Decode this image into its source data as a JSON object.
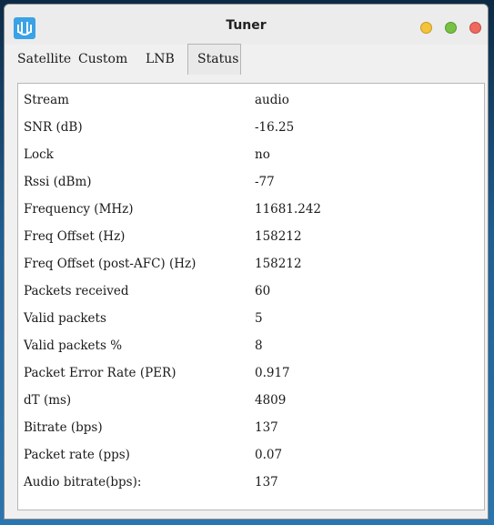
{
  "window": {
    "title": "Tuner"
  },
  "tabs": [
    {
      "label": "Satellite"
    },
    {
      "label": "Custom"
    },
    {
      "label": "LNB"
    },
    {
      "label": "Status"
    }
  ],
  "status": {
    "rows": [
      {
        "label": "Stream",
        "value": "audio"
      },
      {
        "label": "SNR (dB)",
        "value": "-16.25"
      },
      {
        "label": "Lock",
        "value": "no"
      },
      {
        "label": "Rssi (dBm)",
        "value": "-77"
      },
      {
        "label": "Frequency (MHz)",
        "value": "11681.242"
      },
      {
        "label": "Freq Offset (Hz)",
        "value": "158212"
      },
      {
        "label": "Freq Offset (post-AFC) (Hz)",
        "value": "158212"
      },
      {
        "label": "Packets received",
        "value": "60"
      },
      {
        "label": "Valid packets",
        "value": "5"
      },
      {
        "label": "Valid packets %",
        "value": "8"
      },
      {
        "label": "Packet Error Rate (PER)",
        "value": "0.917"
      },
      {
        "label": "dT (ms)",
        "value": "4809"
      },
      {
        "label": "Bitrate (bps)",
        "value": "137"
      },
      {
        "label": "Packet rate (pps)",
        "value": "0.07"
      },
      {
        "label": "Audio bitrate(bps):",
        "value": "137"
      }
    ]
  },
  "colors": {
    "accent": "#3aa2e6",
    "minimize": "#f3c33b",
    "maximize": "#79c142",
    "close": "#ee6a5e"
  },
  "icons": {
    "app": "tuner-app-icon"
  }
}
